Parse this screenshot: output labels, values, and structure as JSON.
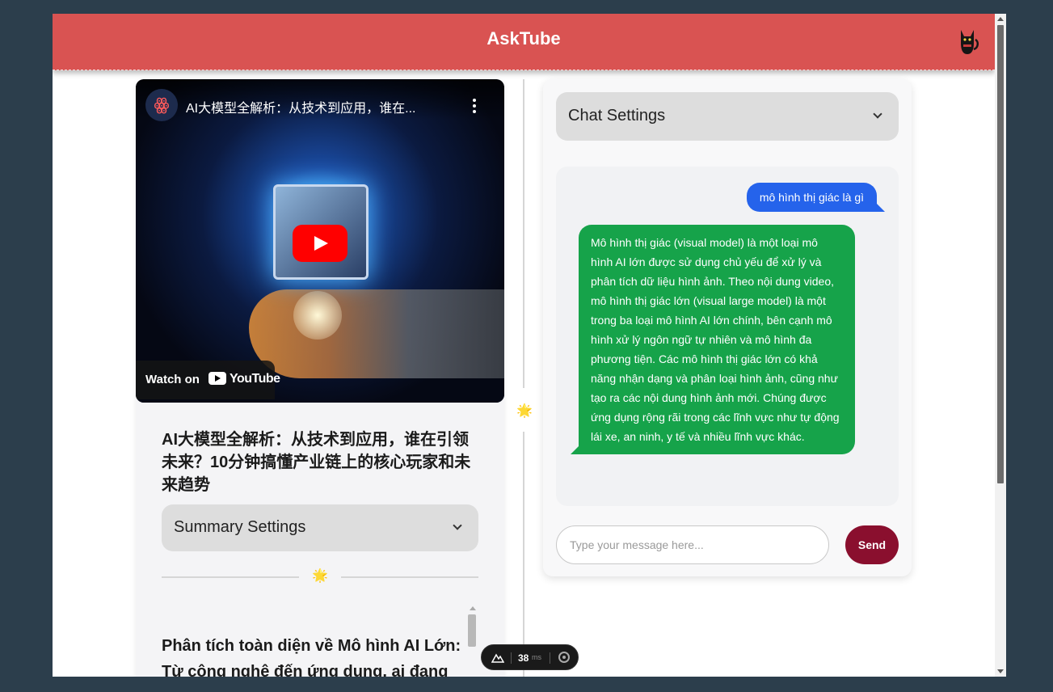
{
  "app": {
    "title": "AskTube",
    "avatar_icon": "black-cat-icon"
  },
  "video": {
    "title": "AI大模型全解析：从技术到应用，谁在...",
    "channel_logo_icon": "channel-logo-icon",
    "watch_on_label": "Watch on",
    "youtube_label": "YouTube"
  },
  "left": {
    "video_title": "AI大模型全解析：从技术到应用，谁在引领未来？10分钟搞懂产业链上的核心玩家和未来趋势",
    "summary_settings_label": "Summary Settings",
    "divider_icon": "🌟",
    "summary_heading": "Phân tích toàn diện về Mô hình AI Lớn: Từ công nghệ đến ứng dụng, ai đang dẫn dắt"
  },
  "center": {
    "divider_icon": "🌟"
  },
  "chat": {
    "settings_label": "Chat Settings",
    "messages": [
      {
        "role": "user",
        "text": "mô hình thị giác là gì"
      },
      {
        "role": "assistant",
        "text": "Mô hình thị giác (visual model) là một loại mô hình AI lớn được sử dụng chủ yếu để xử lý và phân tích dữ liệu hình ảnh. Theo nội dung video, mô hình thị giác lớn (visual large model) là một trong ba loại mô hình AI lớn chính, bên cạnh mô hình xử lý ngôn ngữ tự nhiên và mô hình đa phương tiện. Các mô hình thị giác lớn có khả năng nhận dạng và phân loại hình ảnh, cũng như tạo ra các nội dung hình ảnh mới. Chúng được ứng dụng rộng rãi trong các lĩnh vực như tự động lái xe, an ninh, y tế và nhiều lĩnh vực khác."
      }
    ],
    "input_placeholder": "Type your message here...",
    "input_value": "",
    "send_label": "Send"
  },
  "devtools": {
    "render_time": "38",
    "render_unit": "ms"
  },
  "colors": {
    "header_bg": "#d95352",
    "user_bubble": "#2563eb",
    "bot_bubble": "#16a34a",
    "send_button": "#8a0f2e",
    "page_bg": "#2c3e4c"
  }
}
